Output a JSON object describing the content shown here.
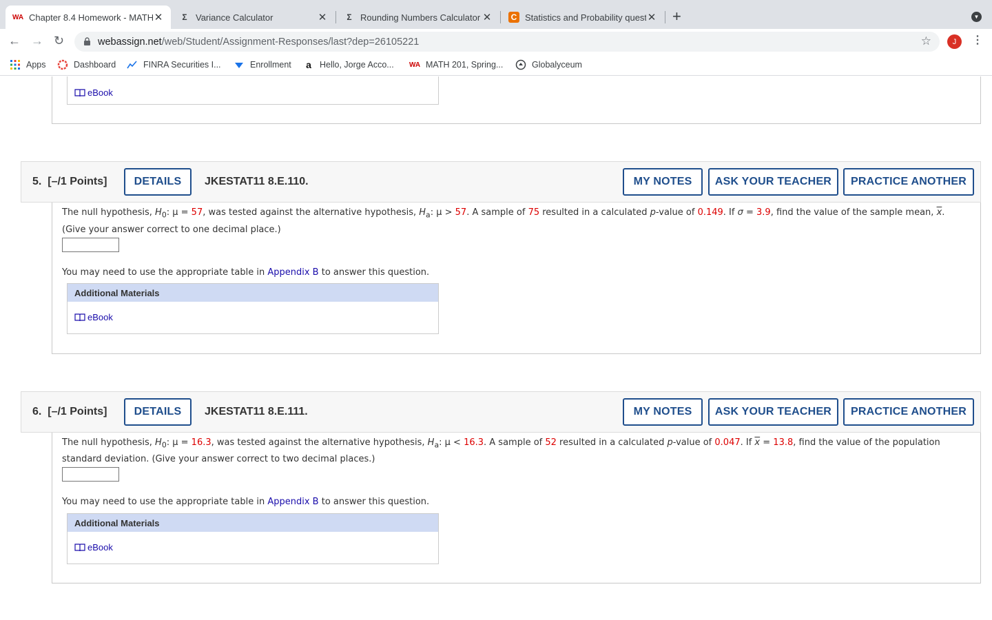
{
  "tabs": [
    {
      "title": "Chapter 8.4 Homework - MATH",
      "favicon": "WA"
    },
    {
      "title": "Variance Calculator",
      "favicon": "Σ"
    },
    {
      "title": "Rounding Numbers Calculator",
      "favicon": "Σ"
    },
    {
      "title": "Statistics and Probability quest",
      "favicon": "C"
    }
  ],
  "newtab": "+",
  "address": {
    "domain": "webassign.net",
    "path": "/web/Student/Assignment-Responses/last?dep=26105221"
  },
  "profile_initial": "J",
  "bookmarks": [
    {
      "label": "Apps",
      "icon": "apps-grid-icon"
    },
    {
      "label": "Dashboard",
      "icon": "dashboard-icon"
    },
    {
      "label": "FINRA Securities I...",
      "icon": "finra-icon"
    },
    {
      "label": "Enrollment",
      "icon": "enrollment-icon"
    },
    {
      "label": "Hello, Jorge Acco...",
      "icon": "amazon-icon",
      "glyph": "a"
    },
    {
      "label": "MATH 201, Spring...",
      "icon": "webassign-icon",
      "glyph": "WA"
    },
    {
      "label": "Globalyceum",
      "icon": "globalyceum-icon"
    }
  ],
  "ebook_label": "eBook",
  "additional_materials": "Additional Materials",
  "buttons": {
    "details": "DETAILS",
    "my_notes": "MY NOTES",
    "ask_teacher": "ASK YOUR TEACHER",
    "practice": "PRACTICE ANOTHER"
  },
  "appendix_note": {
    "before": "You may need to use the appropriate table in ",
    "link": "Appendix B",
    "after": " to answer this question."
  },
  "questions": [
    {
      "number": "5.",
      "points": "[–/1 Points]",
      "code": "JKESTAT11 8.E.110.",
      "mu0": "57",
      "alt_op": ">",
      "mu_a": "57",
      "n": "75",
      "p": "0.149",
      "given_var": "σ",
      "given_val": "3.9",
      "line1_end": ", find the value of the sample mean, ",
      "line1_tail": "x",
      "line1_period": ".",
      "line2": "(Give your answer correct to one decimal place.)"
    },
    {
      "number": "6.",
      "points": "[–/1 Points]",
      "code": "JKESTAT11 8.E.111.",
      "mu0": "16.3",
      "alt_op": "<",
      "mu_a": "16.3",
      "n": "52",
      "p": "0.047",
      "given_var": "x",
      "given_val": "13.8",
      "line1_end": ", find the value of the population",
      "line1_tail": "",
      "line1_period": "",
      "line2": "standard deviation. (Give your answer correct to two decimal places.)"
    }
  ],
  "text": {
    "null_hyp": "The null hypothesis, ",
    "H": "H",
    "sub0": "0",
    "suba": "a",
    "mu_eq": ": μ = ",
    "tested": ", was tested against the alternative hypothesis, ",
    "mu_colon": ": μ ",
    "sample_of": ". A sample of ",
    "resulted": " resulted in a calculated ",
    "p_italic": "p",
    "value_of": "-value of ",
    "if": ". If ",
    "eq": " = "
  },
  "colors": {
    "button_blue": "#1f4e8c",
    "highlight_red": "#dd0000",
    "materials_header": "#cfdaf3"
  }
}
